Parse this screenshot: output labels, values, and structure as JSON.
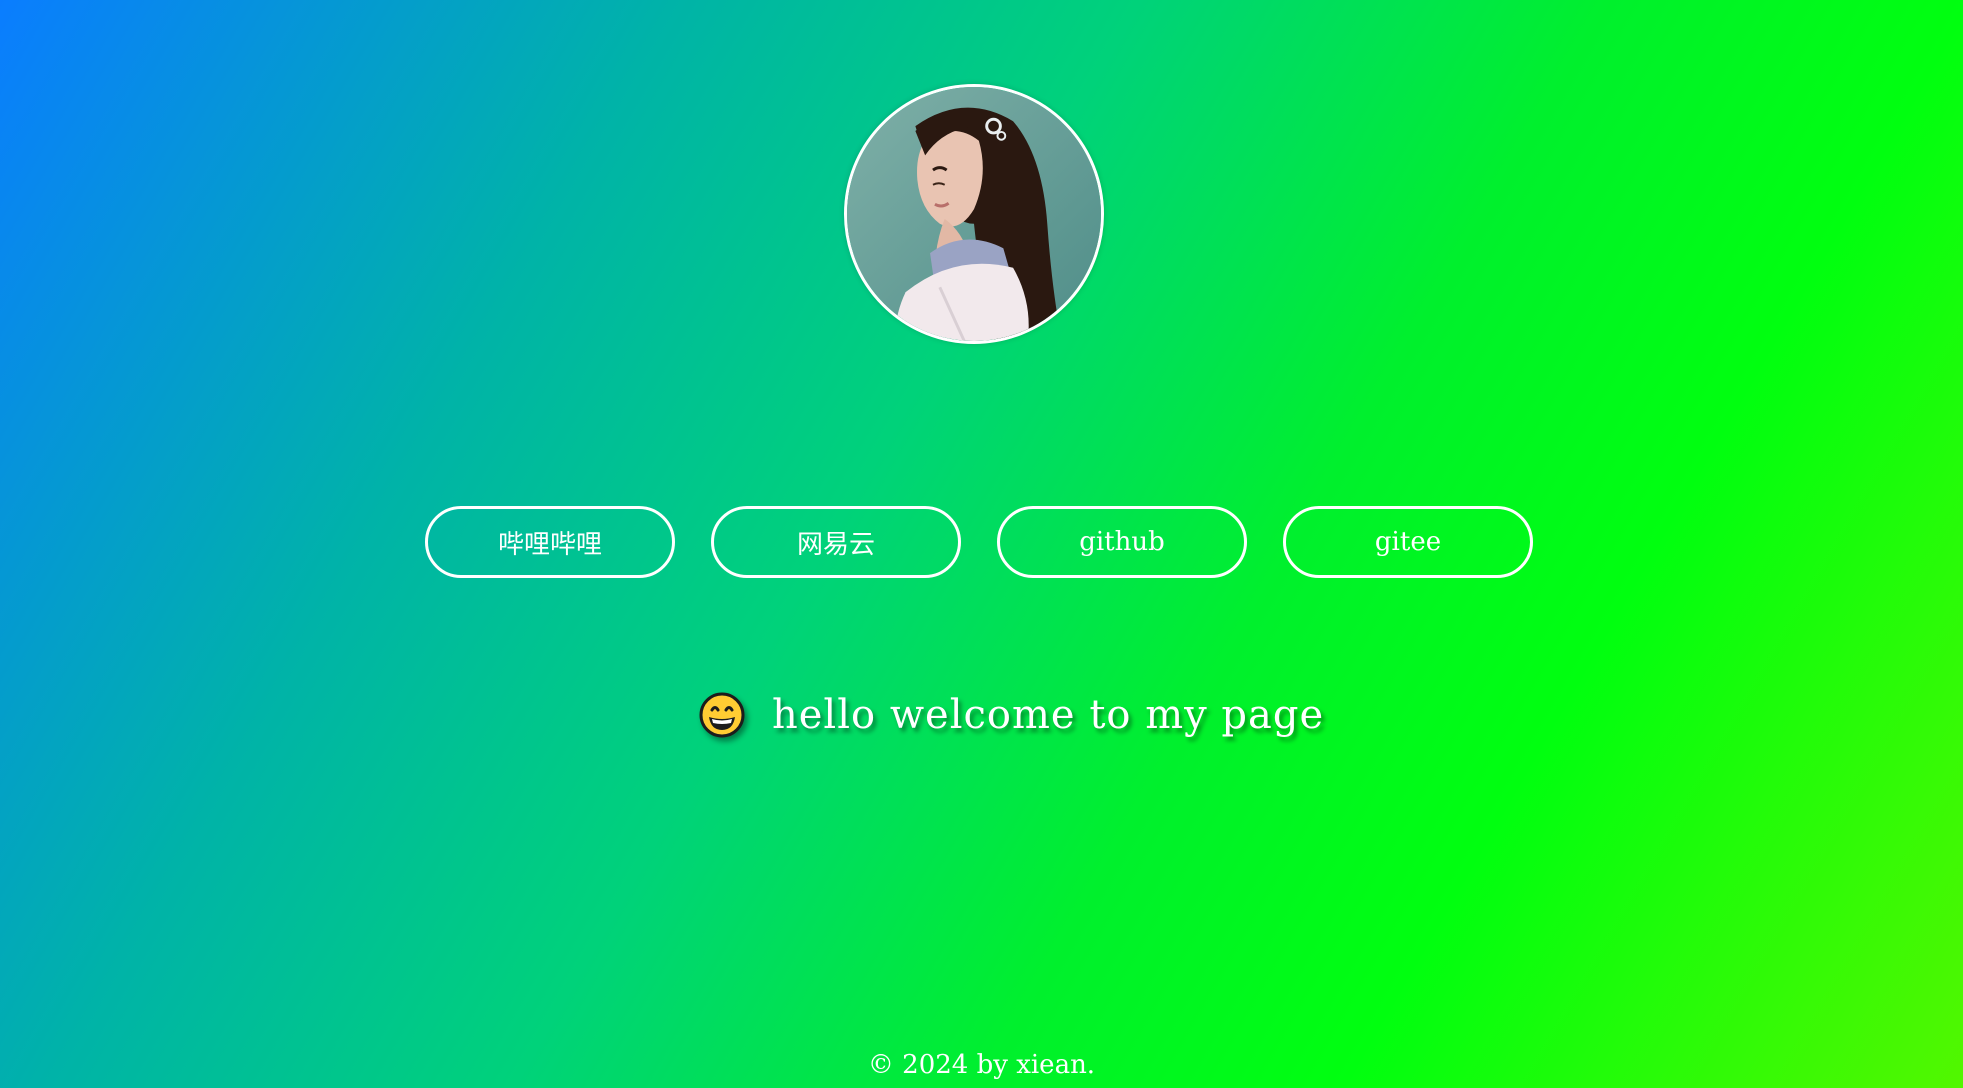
{
  "profile": {
    "avatar_icon": "profile-photo"
  },
  "links": [
    {
      "label": "哔哩哔哩"
    },
    {
      "label": "网易云"
    },
    {
      "label": "github"
    },
    {
      "label": "gitee"
    }
  ],
  "greeting": {
    "emoji_icon": "grinning-face-icon",
    "text": "hello welcome to my page"
  },
  "footer": {
    "text": "© 2024 by xiean."
  },
  "colors": {
    "gradient_start": "#0a7dff",
    "gradient_mid": "#00d27a",
    "gradient_end": "#00ff0f",
    "foreground": "#ffffff"
  }
}
